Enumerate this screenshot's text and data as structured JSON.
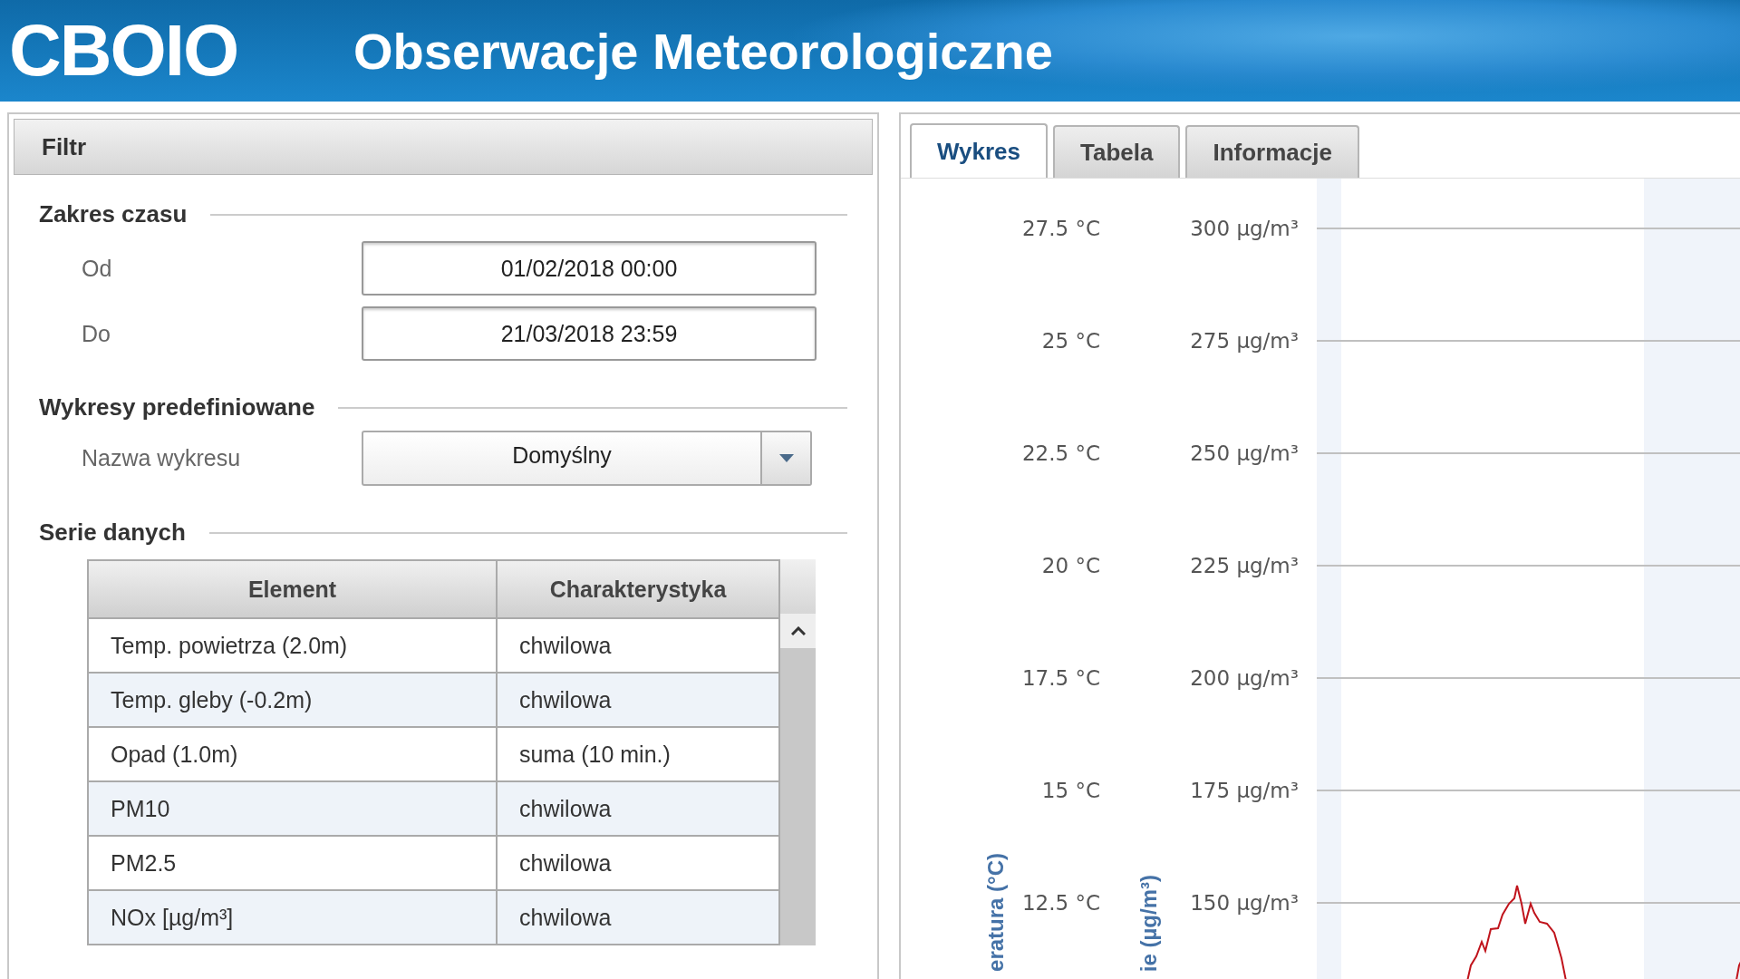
{
  "header": {
    "logo": "CBOIO",
    "title": "Obserwacje Meteorologiczne"
  },
  "filter": {
    "title": "Filtr",
    "time_range": {
      "legend": "Zakres czasu",
      "from_label": "Od",
      "from_value": "01/02/2018 00:00",
      "to_label": "Do",
      "to_value": "21/03/2018 23:59"
    },
    "predefined": {
      "legend": "Wykresy predefiniowane",
      "label": "Nazwa wykresu",
      "value": "Domyślny"
    },
    "series": {
      "legend": "Serie danych",
      "columns": [
        "Element",
        "Charakterystyka"
      ],
      "rows": [
        {
          "element": "Temp. powietrza (2.0m)",
          "characteristic": "chwilowa"
        },
        {
          "element": "Temp. gleby (-0.2m)",
          "characteristic": "chwilowa"
        },
        {
          "element": "Opad (1.0m)",
          "characteristic": "suma (10 min.)"
        },
        {
          "element": "PM10",
          "characteristic": "chwilowa"
        },
        {
          "element": "PM2.5",
          "characteristic": "chwilowa"
        },
        {
          "element": "NOx [µg/m³]",
          "characteristic": "chwilowa"
        }
      ]
    }
  },
  "tabs": [
    {
      "label": "Wykres",
      "selected": true
    },
    {
      "label": "Tabela",
      "selected": false
    },
    {
      "label": "Informacje",
      "selected": false
    }
  ],
  "chart": {
    "left_axis_title": "eratura (°C)",
    "right_axis_title": "ie (µg/m³)",
    "left_ticks": [
      "27.5 °C",
      "25 °C",
      "22.5 °C",
      "20 °C",
      "17.5 °C",
      "15 °C",
      "12.5 °C"
    ],
    "right_ticks": [
      "300 µg/m³",
      "275 µg/m³",
      "250 µg/m³",
      "225 µg/m³",
      "200 µg/m³",
      "175 µg/m³",
      "150 µg/m³"
    ]
  }
}
